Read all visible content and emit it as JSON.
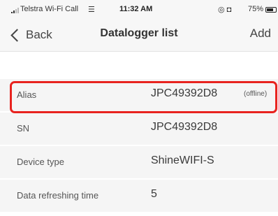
{
  "status_bar": {
    "carrier": "Telstra Wi-Fi Call",
    "wifi_icon": "wifi-icon",
    "time": "11:32 AM",
    "icons": "◎ ◘",
    "battery_pct": "75%",
    "battery_level": 0.75
  },
  "nav": {
    "back_label": "Back",
    "title": "Datalogger list",
    "add_label": "Add"
  },
  "rows": [
    {
      "label": "Alias",
      "value": "JPC49392D8",
      "badge": "(offline)"
    },
    {
      "label": "SN",
      "value": "JPC49392D8",
      "badge": ""
    },
    {
      "label": "Device type",
      "value": "ShineWIFI-S",
      "badge": ""
    },
    {
      "label": "Data refreshing time",
      "value": "5",
      "badge": ""
    }
  ],
  "highlight_color": "#e8231f"
}
